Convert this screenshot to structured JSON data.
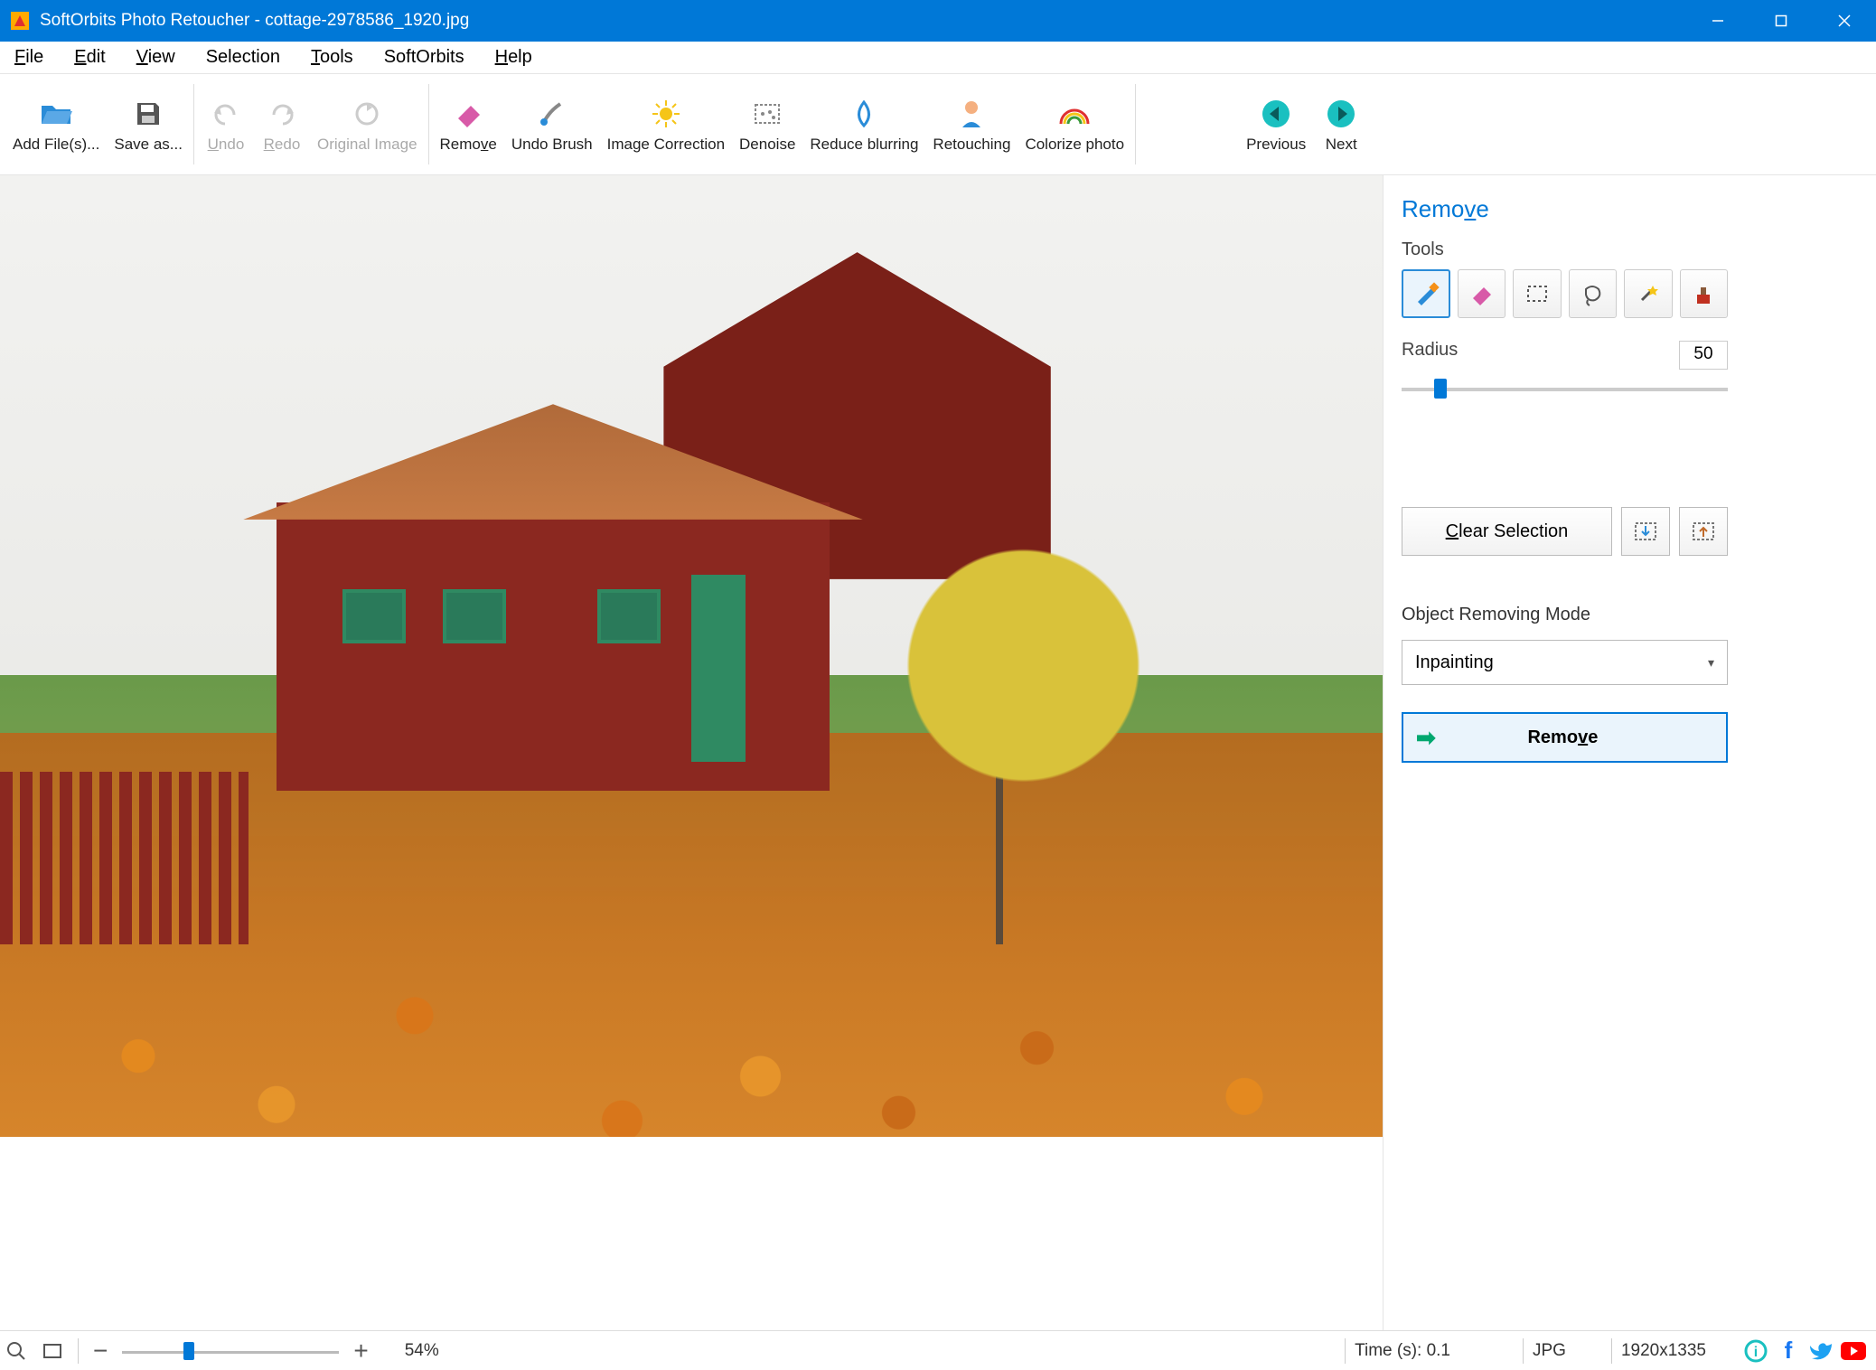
{
  "window": {
    "title": "SoftOrbits Photo Retoucher - cottage-2978586_1920.jpg"
  },
  "menu": {
    "file": "File",
    "edit": "Edit",
    "view": "View",
    "selection": "Selection",
    "tools": "Tools",
    "softorbits": "SoftOrbits",
    "help": "Help"
  },
  "toolbar": {
    "add_files": "Add File(s)...",
    "save_as": "Save as...",
    "undo": "Undo",
    "redo": "Redo",
    "original_image": "Original Image",
    "remove": "Remove",
    "undo_brush": "Undo Brush",
    "image_correction": "Image Correction",
    "denoise": "Denoise",
    "reduce_blurring": "Reduce blurring",
    "retouching": "Retouching",
    "colorize_photo": "Colorize photo",
    "previous": "Previous",
    "next": "Next"
  },
  "panel": {
    "title": "Remove",
    "tools_label": "Tools",
    "radius_label": "Radius",
    "radius_value": "50",
    "slider_percent": 10,
    "clear_selection": "Clear Selection",
    "mode_label": "Object Removing Mode",
    "mode_value": "Inpainting",
    "remove_button": "Remove"
  },
  "status": {
    "zoom_percent": "54%",
    "zoom_slider_percent": 28,
    "time": "Time (s): 0.1",
    "format": "JPG",
    "dimensions": "1920x1335"
  },
  "colors": {
    "accent": "#0078d7"
  }
}
